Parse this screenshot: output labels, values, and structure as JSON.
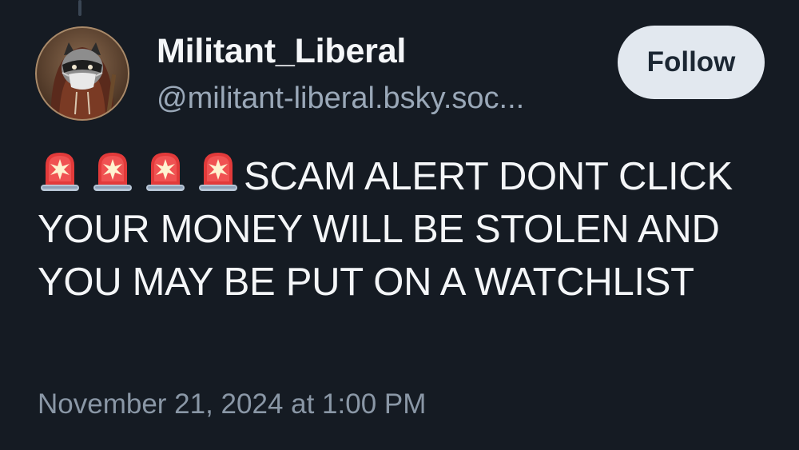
{
  "post": {
    "author": {
      "display_name": "Militant_Liberal",
      "handle": "@militant-liberal.bsky.soc..."
    },
    "follow_label": "Follow",
    "emoji": [
      "police-car-light-icon",
      "police-car-light-icon",
      "police-car-light-icon",
      "police-car-light-icon"
    ],
    "text": "SCAM ALERT DONT CLICK YOUR MONEY WILL BE STOLEN AND YOU MAY BE PUT ON A WATCHLIST",
    "timestamp": "November 21, 2024 at 1:00 PM"
  },
  "colors": {
    "background": "#151b23",
    "follow_button": "#e2e8ef",
    "handle_text": "#9aa8b8",
    "timestamp_text": "#8a97a6"
  }
}
